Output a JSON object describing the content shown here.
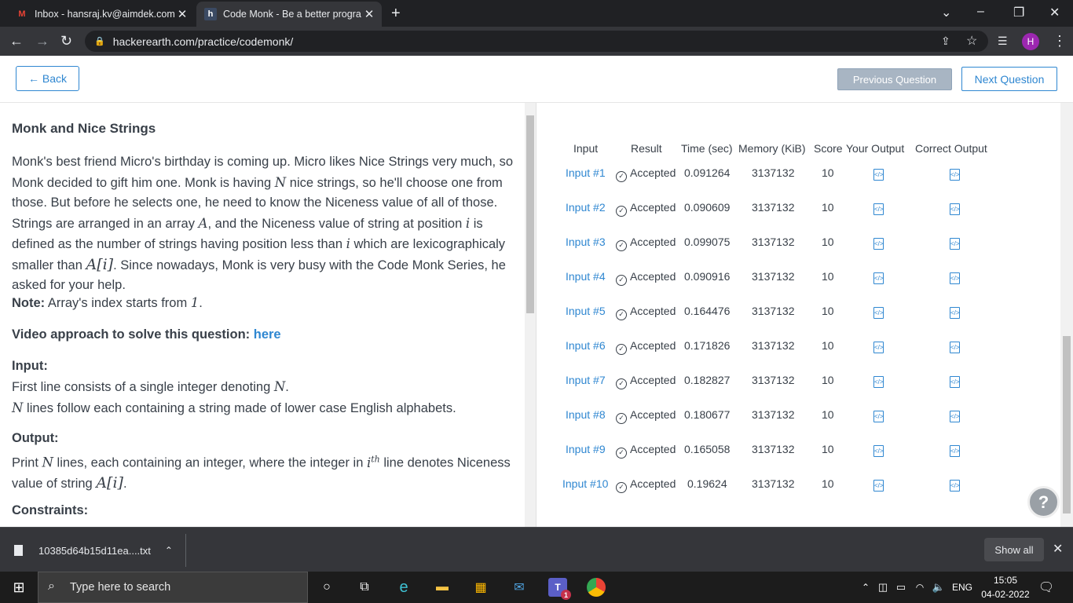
{
  "browser": {
    "tabs": [
      {
        "title": "Inbox - hansraj.kv@aimdek.com",
        "icon": "gmail-icon",
        "active": false
      },
      {
        "title": "Code Monk - Be a better program",
        "icon": "hackerearth-icon",
        "active": true
      }
    ],
    "url": "hackerearth.com/practice/codemonk/",
    "profile_initial": "H"
  },
  "header": {
    "back_label": "← Back",
    "prev_label": "Previous Question",
    "next_label": "Next Question"
  },
  "problem": {
    "title": "Monk and Nice Strings",
    "para1_a": "Monk's best friend Micro's birthday is coming up. Micro likes Nice Strings very much, so Monk decided to gift him one. Monk is having ",
    "N": "N",
    "para1_b": " nice strings, so he'll choose one from those. But before he selects one, he need to know the Niceness value of all of those. Strings are arranged in an array ",
    "A": "A",
    "para1_c": ", and the Niceness value of string at position ",
    "i": "i",
    "para1_d": " is defined as the number of strings having position less than ",
    "para1_e": " which are lexicographicaly smaller than ",
    "Ai": "A[i]",
    "para1_f": ". Since nowadays, Monk is very busy with the Code Monk Series, he asked for your help.",
    "note_label": "Note:",
    "note_text": " Array's index starts from ",
    "note_one": "1",
    "video_label": "Video approach to solve this question:",
    "video_link": "here",
    "input_label": "Input:",
    "input_line1_a": "First line consists of a single integer denoting ",
    "input_line2_b": " lines follow each containing a string made of lower case English alphabets.",
    "output_label": "Output:",
    "output_a": "Print ",
    "output_b": " lines, each containing an integer, where the integer in ",
    "ith": "i",
    "th": "th",
    "output_c": " line denotes Niceness value of string ",
    "constraints_label": "Constraints:"
  },
  "results": {
    "headers": [
      "Input",
      "Result",
      "Time (sec)",
      "Memory (KiB)",
      "Score",
      "Your Output",
      "Correct Output"
    ],
    "rows": [
      {
        "input": "Input #1",
        "result": "Accepted",
        "time": "0.091264",
        "memory": "3137132",
        "score": "10"
      },
      {
        "input": "Input #2",
        "result": "Accepted",
        "time": "0.090609",
        "memory": "3137132",
        "score": "10"
      },
      {
        "input": "Input #3",
        "result": "Accepted",
        "time": "0.099075",
        "memory": "3137132",
        "score": "10"
      },
      {
        "input": "Input #4",
        "result": "Accepted",
        "time": "0.090916",
        "memory": "3137132",
        "score": "10"
      },
      {
        "input": "Input #5",
        "result": "Accepted",
        "time": "0.164476",
        "memory": "3137132",
        "score": "10"
      },
      {
        "input": "Input #6",
        "result": "Accepted",
        "time": "0.171826",
        "memory": "3137132",
        "score": "10"
      },
      {
        "input": "Input #7",
        "result": "Accepted",
        "time": "0.182827",
        "memory": "3137132",
        "score": "10"
      },
      {
        "input": "Input #8",
        "result": "Accepted",
        "time": "0.180677",
        "memory": "3137132",
        "score": "10"
      },
      {
        "input": "Input #9",
        "result": "Accepted",
        "time": "0.165058",
        "memory": "3137132",
        "score": "10"
      },
      {
        "input": "Input #10",
        "result": "Accepted",
        "time": "0.19624",
        "memory": "3137132",
        "score": "10"
      }
    ]
  },
  "download": {
    "filename": "10385d64b15d11ea....txt",
    "show_all": "Show all"
  },
  "taskbar": {
    "search_placeholder": "Type here to search",
    "lang": "ENG",
    "time": "15:05",
    "date": "04-02-2022",
    "teams_badge": "1"
  },
  "colors": {
    "accent": "#2f87d1",
    "text": "#394049",
    "chrome_dark": "#202124"
  }
}
